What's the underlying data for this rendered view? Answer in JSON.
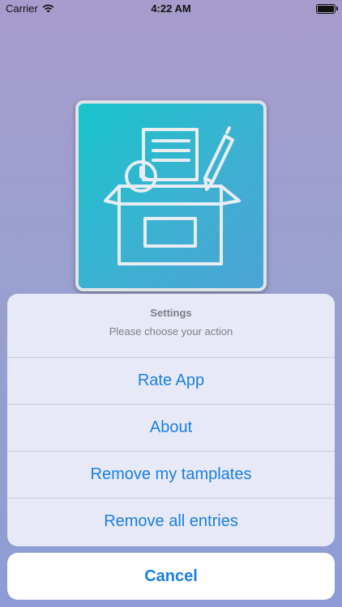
{
  "status_bar": {
    "carrier": "Carrier",
    "time": "4:22 AM"
  },
  "icons": {
    "wifi": "wifi-icon",
    "battery": "battery-icon",
    "app": "document-box-icon"
  },
  "colors": {
    "accent": "#1a7fe0",
    "icon_teal": "#18c4cc"
  },
  "action_sheet": {
    "title": "Settings",
    "message": "Please choose your action",
    "options": [
      {
        "label": "Rate App"
      },
      {
        "label": "About"
      },
      {
        "label": "Remove my tamplates"
      },
      {
        "label": "Remove all entries"
      }
    ],
    "cancel_label": "Cancel"
  }
}
